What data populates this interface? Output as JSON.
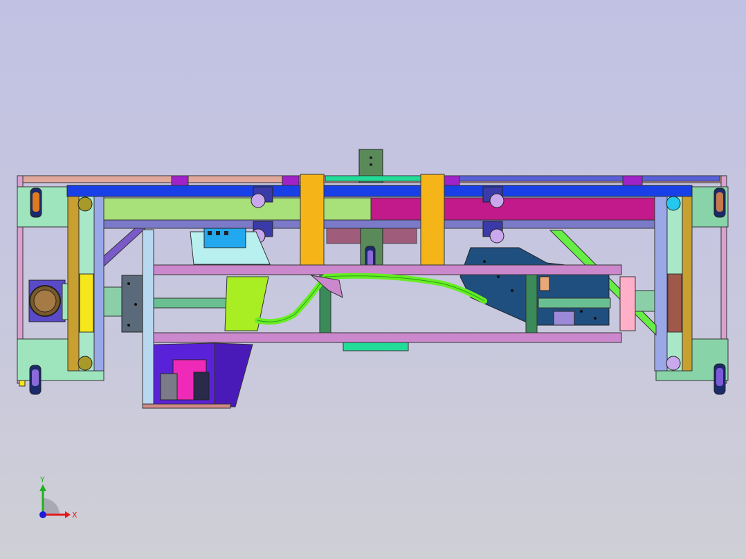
{
  "viewport": {
    "background_top": "#c1c1e3",
    "background_bottom": "#cfcfd6"
  },
  "triad": {
    "x_label": "X",
    "y_label": "Y",
    "x_color": "#e11b1b",
    "y_color": "#1fb01f",
    "z_color": "#1b1bd8"
  },
  "colors": {
    "frame_pink": "#d9a0d0",
    "frame_purple": "#8a7ac8",
    "rail_blue": "#1840e6",
    "beam_green": "#a8e07a",
    "beam_magenta": "#c21a8a",
    "post_orange": "#f5b418",
    "beam_violet": "#cc88cc",
    "tube_green": "#66ee22",
    "plate_mint": "#9ee4bd",
    "bracket_navy": "#1f4f7f",
    "hopper_indigo": "#5a22d8",
    "bearing_lilac": "#c9a8ee",
    "bearing_cyan": "#22c8ee",
    "wheel_orange": "#e07a1e",
    "block_yellow": "#f6e61c"
  }
}
